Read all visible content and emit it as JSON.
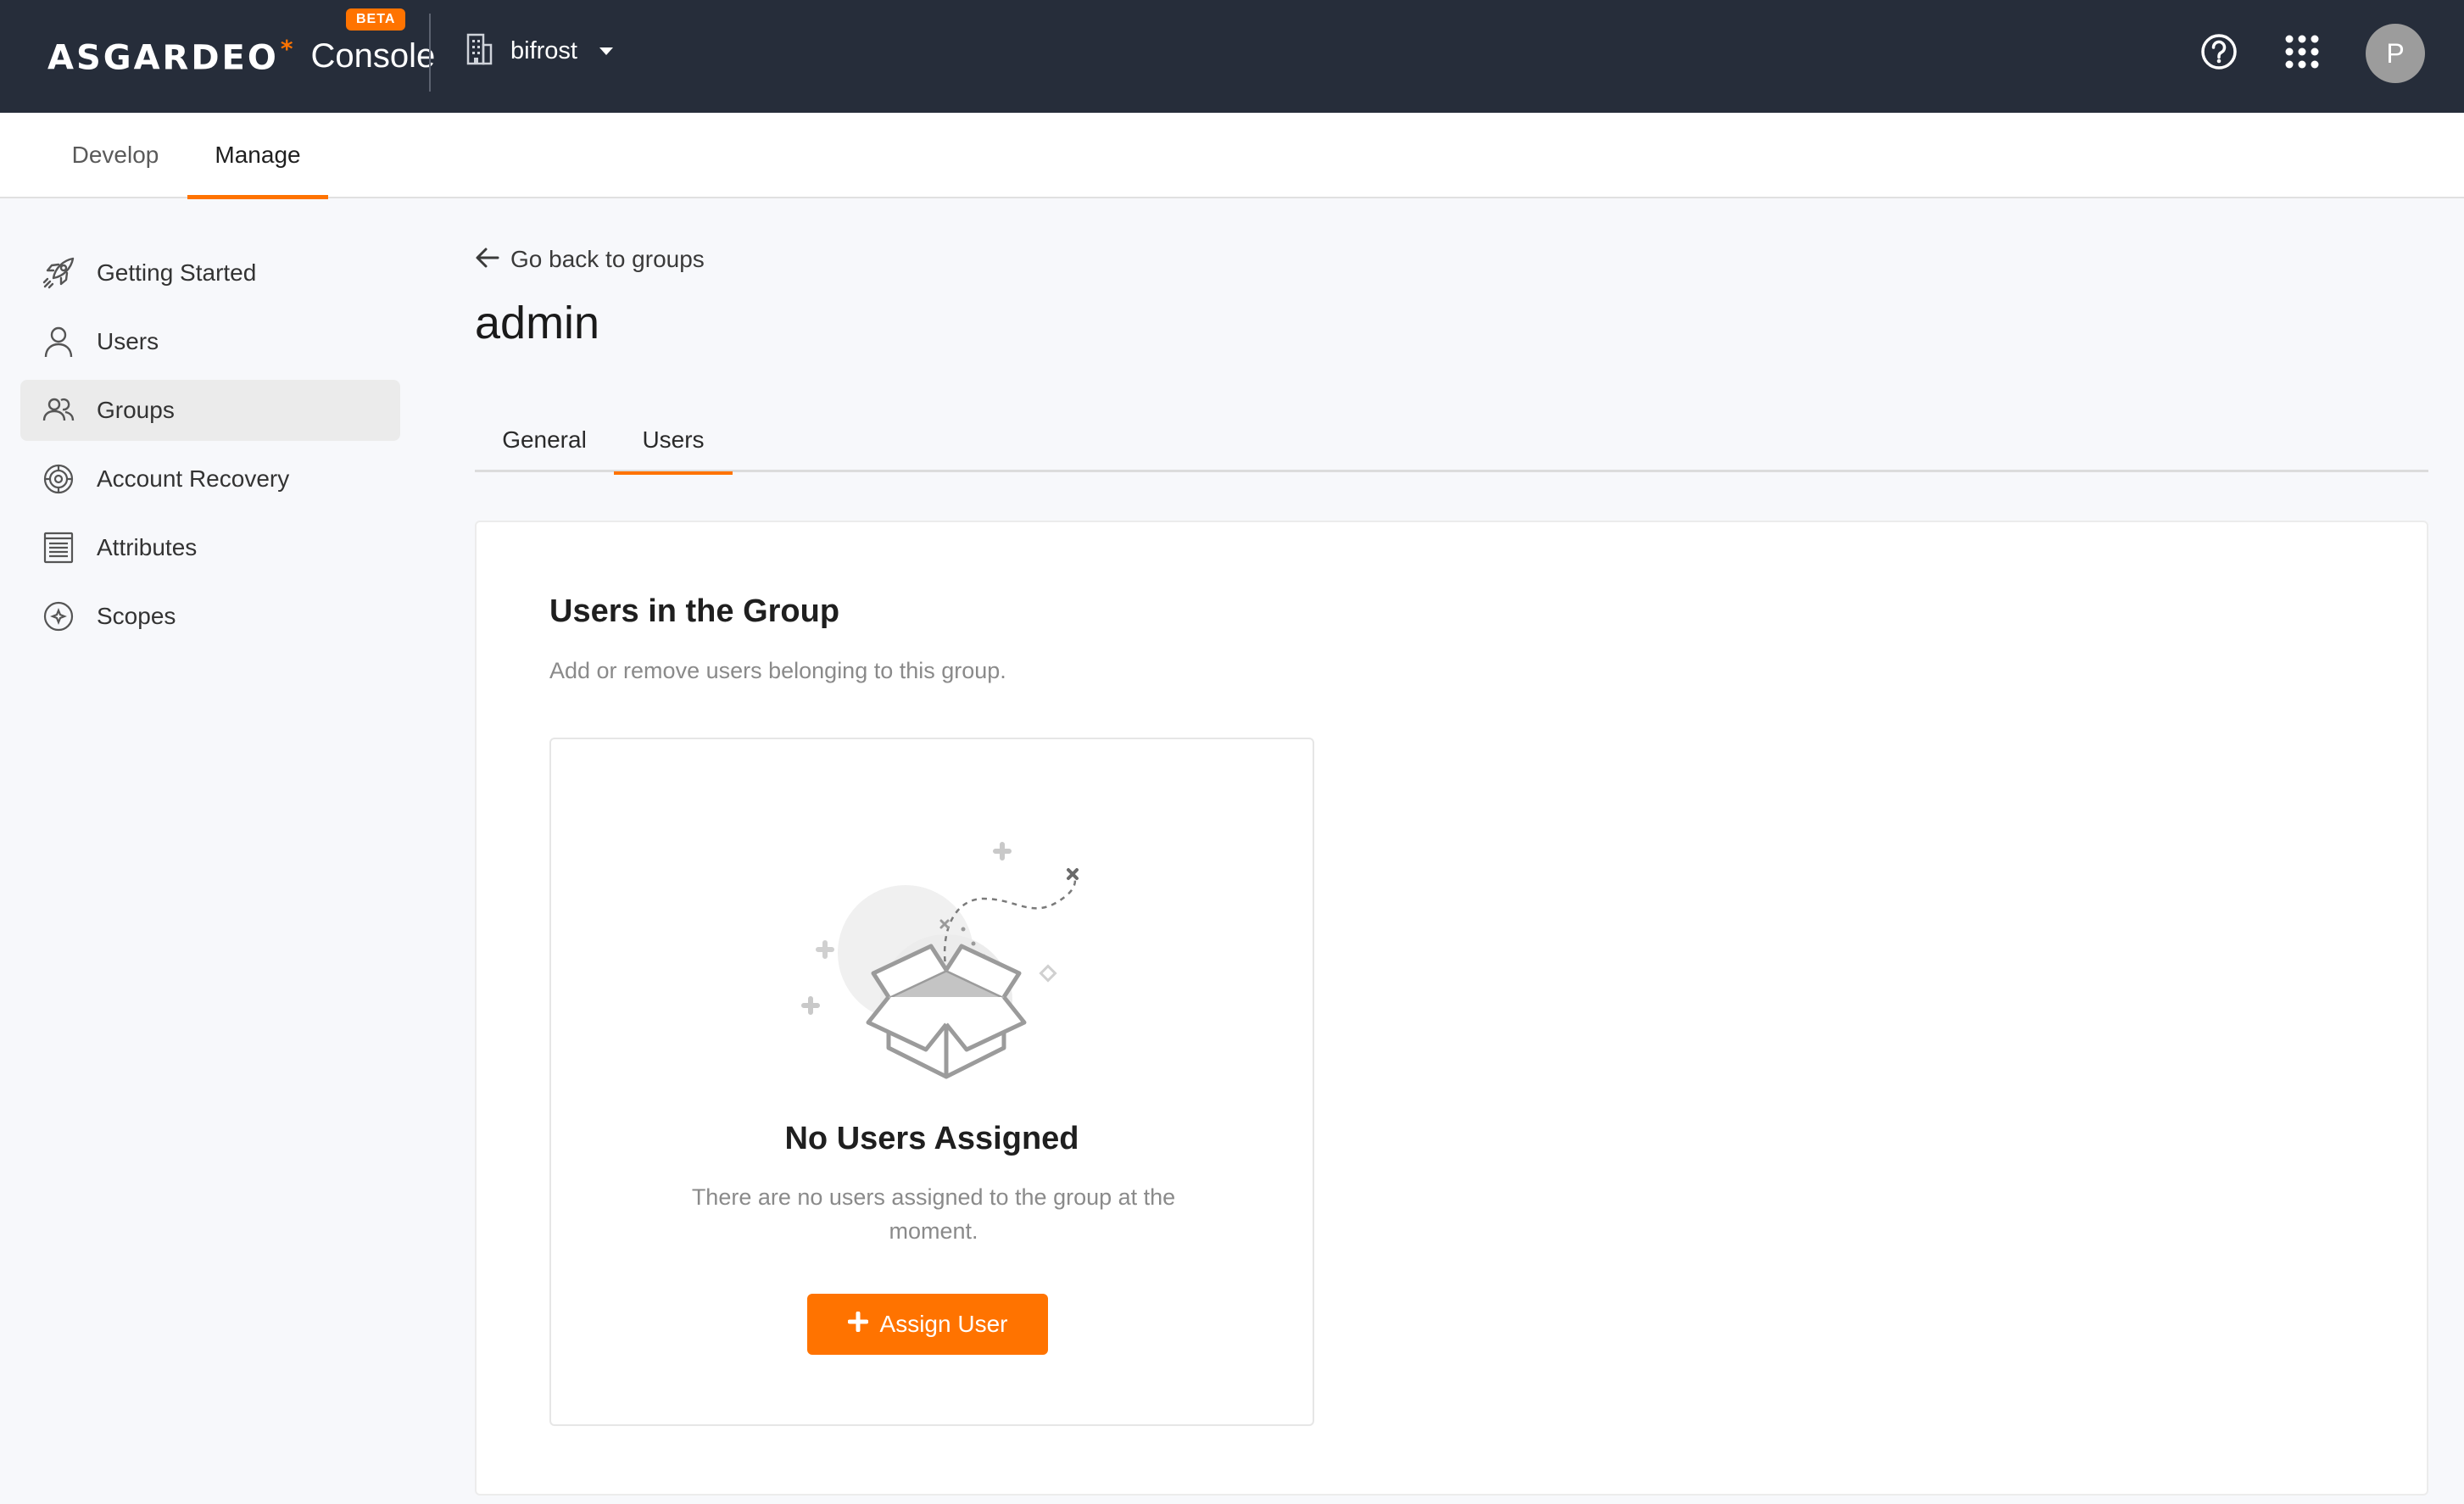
{
  "header": {
    "brand": "ASGARDEO",
    "product": "Console",
    "beta_badge": "BETA",
    "org_name": "bifrost",
    "avatar_initial": "P",
    "accent_color": "#ff7300",
    "background_color": "#262d3a",
    "icons": [
      "building-icon",
      "help-icon",
      "apps-grid-icon"
    ]
  },
  "subnav": {
    "tabs": [
      {
        "label": "Develop",
        "active": false
      },
      {
        "label": "Manage",
        "active": true
      }
    ]
  },
  "sidebar": {
    "items": [
      {
        "label": "Getting Started",
        "icon": "rocket-icon",
        "active": false
      },
      {
        "label": "Users",
        "icon": "user-icon",
        "active": false
      },
      {
        "label": "Groups",
        "icon": "group-icon",
        "active": true
      },
      {
        "label": "Account Recovery",
        "icon": "recovery-icon",
        "active": false
      },
      {
        "label": "Attributes",
        "icon": "list-icon",
        "active": false
      },
      {
        "label": "Scopes",
        "icon": "scopes-icon",
        "active": false
      }
    ]
  },
  "main": {
    "back_link": "Go back to groups",
    "title": "admin",
    "tabs": [
      {
        "label": "General",
        "active": false
      },
      {
        "label": "Users",
        "active": true
      }
    ],
    "section_title": "Users in the Group",
    "section_subtitle": "Add or remove users belonging to this group.",
    "empty_state": {
      "title": "No Users Assigned",
      "description": "There are no users assigned to the group at the moment.",
      "button_label": "Assign User",
      "illustration": "open-box-illustration"
    }
  }
}
